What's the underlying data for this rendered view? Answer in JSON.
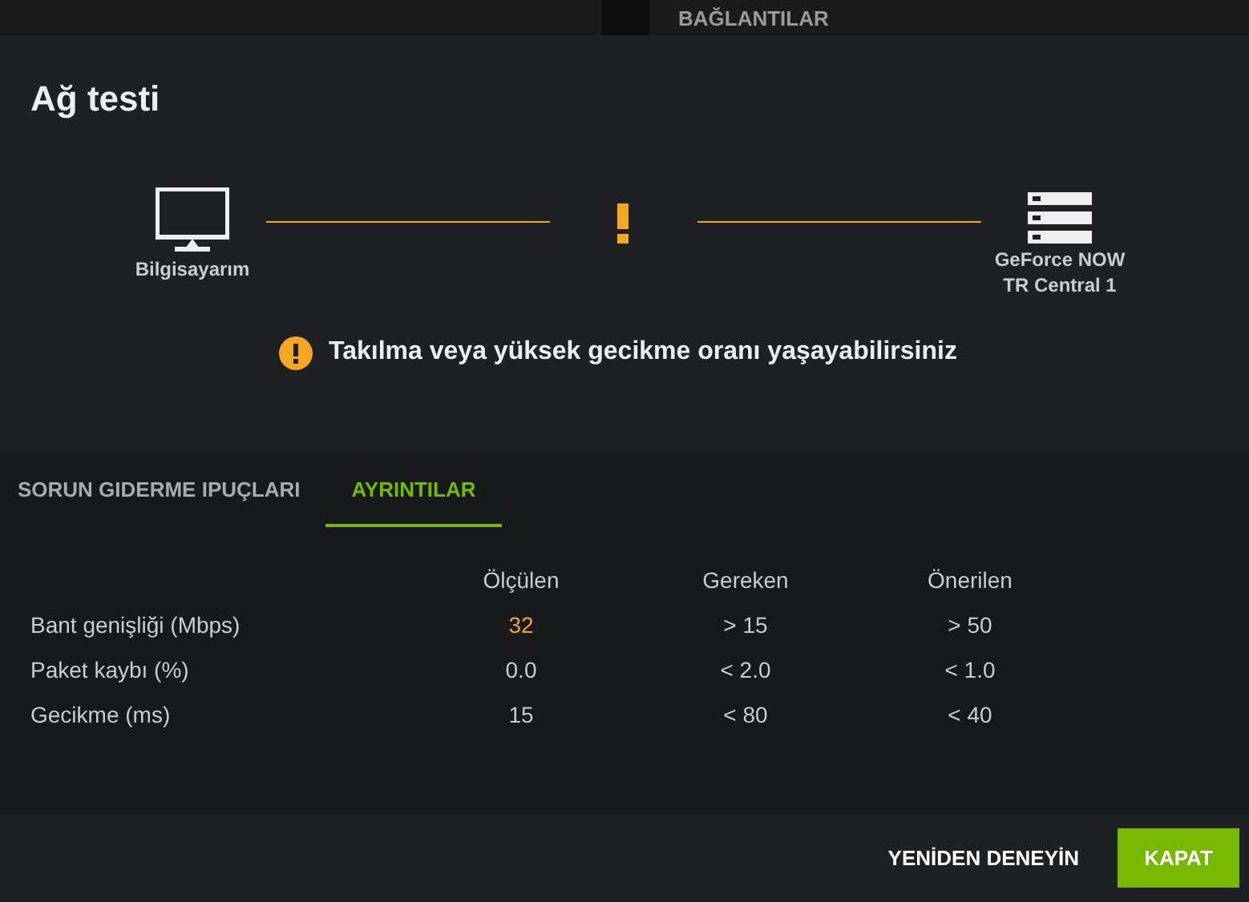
{
  "top_bar": {
    "title": "BAĞLANTILAR"
  },
  "dialog": {
    "title": "Ağ testi",
    "connection": {
      "warning": true,
      "source": "Bilgisayarım",
      "target_lines": [
        "GeForce NOW",
        "TR Central 1"
      ]
    },
    "message": "Takılma veya yüksek gecikme oranı yaşayabilirsiniz"
  },
  "tabs": [
    {
      "label": "SORUN GIDERME IPUÇLARI",
      "selected": false
    },
    {
      "label": "AYRINTILAR",
      "selected": true
    }
  ],
  "table": {
    "columns": [
      "Ölçülen",
      "Gereken",
      "Önerilen"
    ],
    "rows": [
      {
        "label": "Bant genişliği (Mbps)",
        "measured": "32",
        "warning": true,
        "required": "> 15",
        "recommended": "> 50"
      },
      {
        "label": "Paket kaybı (%)",
        "measured": "0.0",
        "warning": false,
        "required": "< 2.0",
        "recommended": "< 1.0"
      },
      {
        "label": "Gecikme (ms)",
        "measured": "15",
        "warning": false,
        "required": "< 80",
        "recommended": "< 40"
      }
    ]
  },
  "buttons": [
    {
      "label": "YENİDEN DENEYİN",
      "kind": "text"
    },
    {
      "label": "KAPAT",
      "kind": "primary"
    }
  ]
}
